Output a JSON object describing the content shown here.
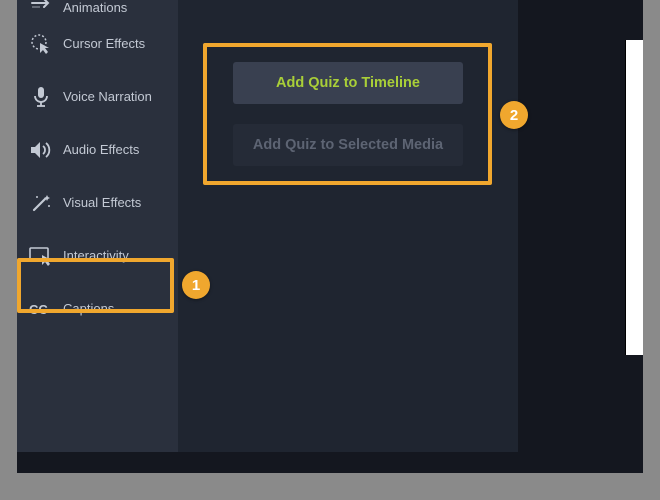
{
  "sidebar": {
    "items": [
      {
        "label": "Animations"
      },
      {
        "label": "Cursor Effects"
      },
      {
        "label": "Voice Narration"
      },
      {
        "label": "Audio Effects"
      },
      {
        "label": "Visual Effects"
      },
      {
        "label": "Interactivity"
      },
      {
        "label": "Captions"
      }
    ]
  },
  "panel": {
    "add_timeline": "Add Quiz to Timeline",
    "add_selected": "Add Quiz to Selected Media"
  },
  "callouts": {
    "badge1": "1",
    "badge2": "2"
  },
  "colors": {
    "accent": "#a9cf38",
    "highlight": "#f0a72e",
    "sidebar_bg": "#2a303d",
    "panel_bg": "#1f2530"
  }
}
